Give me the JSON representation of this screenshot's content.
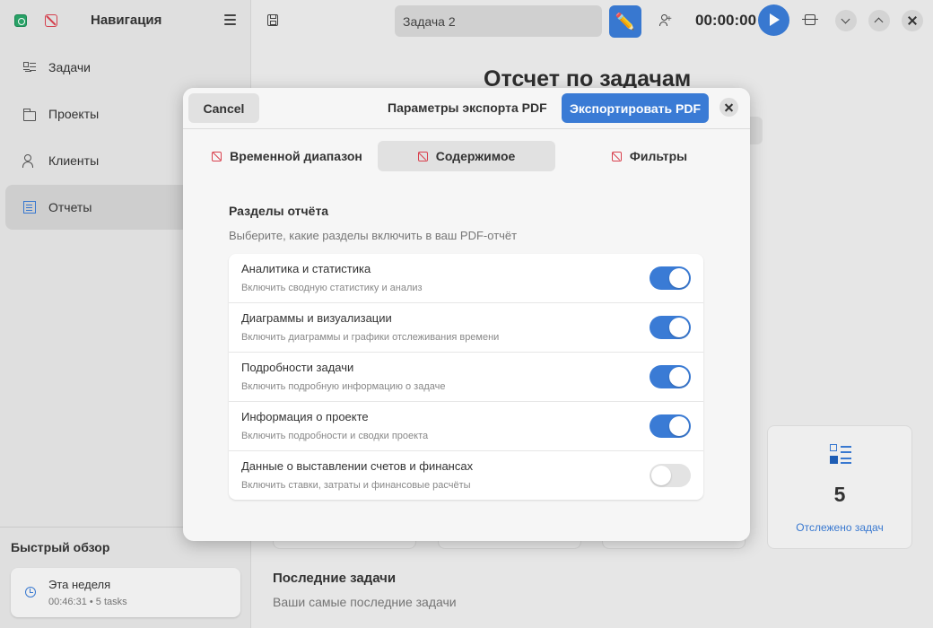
{
  "sidebar": {
    "title": "Навигация",
    "items": [
      {
        "label": "Задачи",
        "icon": "tasks-icon",
        "active": false
      },
      {
        "label": "Проекты",
        "icon": "folder-icon",
        "active": false
      },
      {
        "label": "Клиенты",
        "icon": "client-icon",
        "active": false
      },
      {
        "label": "Отчеты",
        "icon": "reports-icon",
        "active": true
      }
    ],
    "quick_overview": {
      "title": "Быстрый обзор",
      "period": "Эта неделя",
      "summary": "00:46:31 • 5 tasks"
    }
  },
  "topbar": {
    "task_name": "Задача 2",
    "timer": "00:00:00"
  },
  "page": {
    "title": "Отсчет по задачам",
    "stat": {
      "value": "5",
      "label": "Отслежено задач"
    },
    "recent_title": "Последние задачи",
    "recent_subtitle": "Ваши самые последние задачи"
  },
  "dialog": {
    "cancel_label": "Cancel",
    "title": "Параметры экспорта PDF",
    "export_label": "Экспортировать PDF",
    "tabs": [
      {
        "label": "Временной диапазон",
        "active": false
      },
      {
        "label": "Содержимое",
        "active": true
      },
      {
        "label": "Фильтры",
        "active": false
      }
    ],
    "section_title": "Разделы отчёта",
    "section_subtitle": "Выберите, какие разделы включить в ваш PDF-отчёт",
    "options": [
      {
        "label": "Аналитика и статистика",
        "description": "Включить сводную статистику и анализ",
        "enabled": true
      },
      {
        "label": "Диаграммы и визуализации",
        "description": "Включить диаграммы и графики отслеживания времени",
        "enabled": true
      },
      {
        "label": "Подробности задачи",
        "description": "Включить подробную информацию о задаче",
        "enabled": true
      },
      {
        "label": "Информация о проекте",
        "description": "Включить подробности и сводки проекта",
        "enabled": true
      },
      {
        "label": "Данные о выставлении счетов и финансах",
        "description": "Включить ставки, затраты и финансовые расчёты",
        "enabled": false
      }
    ]
  },
  "colors": {
    "accent": "#3a7bd5",
    "missing_icon": "#d9414e",
    "app_icon": "#2aa56a"
  }
}
